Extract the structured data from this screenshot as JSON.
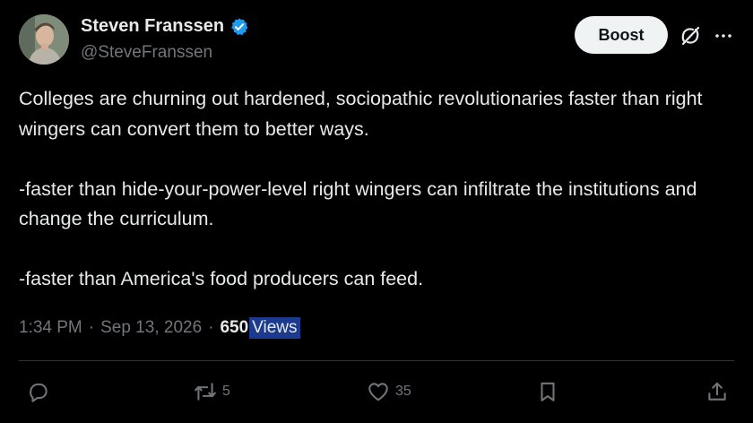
{
  "author": {
    "display_name": "Steven Franssen",
    "handle": "@SteveFranssen",
    "verified": true
  },
  "header": {
    "boost_label": "Boost",
    "grok_icon": "grok-icon",
    "more_icon": "more-horizontal-icon"
  },
  "post": {
    "paragraphs": [
      "Colleges are churning out hardened, sociopathic revolutionaries faster than right wingers can convert them to better ways.",
      "-faster than hide-your-power-level right wingers can infiltrate the institutions and change the curriculum.",
      "-faster than America's food producers can feed."
    ],
    "time": "1:34 PM",
    "separator": "·",
    "date": "Sep 13, 2026",
    "views_count": "650",
    "views_label": "Views"
  },
  "actions": {
    "reply_icon": "reply-icon",
    "repost_icon": "repost-icon",
    "repost_count": "5",
    "like_icon": "heart-icon",
    "like_count": "35",
    "bookmark_icon": "bookmark-icon",
    "share_icon": "share-icon"
  },
  "colors": {
    "background": "#000000",
    "text_primary": "#e7e9ea",
    "text_secondary": "#71767b",
    "verified_badge": "#1d9bf0",
    "views_highlight": "#1d3b8e",
    "divider": "#2f3336",
    "boost_button_bg": "#eff3f4"
  }
}
